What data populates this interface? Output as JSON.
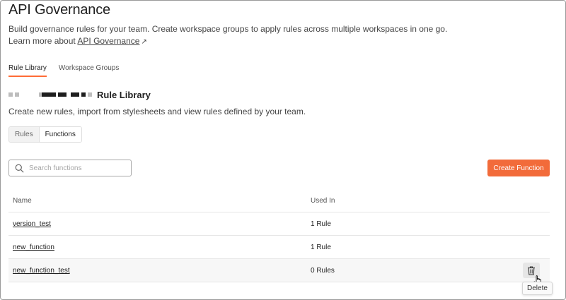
{
  "header": {
    "title": "API Governance",
    "subtitle": "Build governance rules for your team. Create workspace groups to apply rules across multiple workspaces in one go.",
    "learn_prefix": "Learn more about ",
    "learn_link": "API Governance",
    "learn_arrow": "↗"
  },
  "tabs": [
    {
      "label": "Rule Library",
      "active": true
    },
    {
      "label": "Workspace Groups",
      "active": false
    }
  ],
  "section": {
    "title": "Rule Library",
    "description": "Create new rules, import from stylesheets and view rules defined by your team."
  },
  "segmented": [
    {
      "label": "Rules",
      "active": false
    },
    {
      "label": "Functions",
      "active": true
    }
  ],
  "search": {
    "placeholder": "Search functions",
    "value": ""
  },
  "toolbar": {
    "create_label": "Create Function"
  },
  "table": {
    "columns": [
      "Name",
      "Used In"
    ],
    "rows": [
      {
        "name": "version_test",
        "used_in": "1 Rule"
      },
      {
        "name": "new_function",
        "used_in": "1 Rule"
      },
      {
        "name": "new_function_test",
        "used_in": "0 Rules"
      }
    ]
  },
  "tooltip": {
    "text": "Delete"
  },
  "colors": {
    "accent": "#f26b3a",
    "tab_underline": "#ff6c37"
  },
  "icons": {
    "search": "search-icon",
    "delete": "trash-icon",
    "cursor": "hand-pointer-icon",
    "external": "external-link-icon"
  }
}
